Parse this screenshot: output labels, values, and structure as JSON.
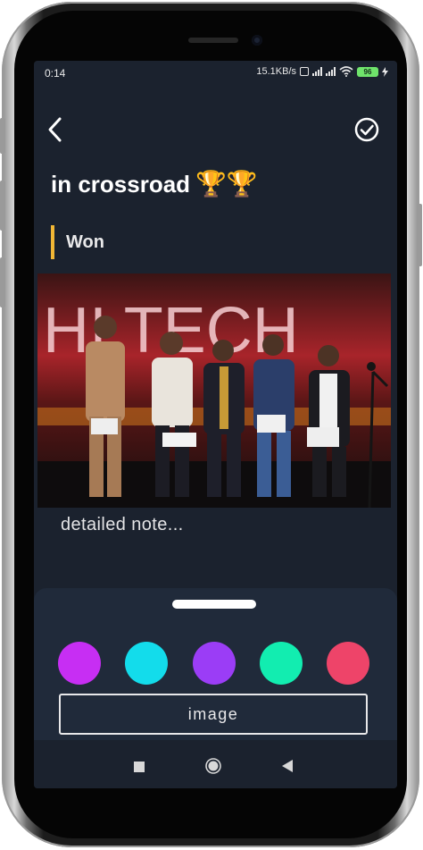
{
  "status_bar": {
    "time": "0:14",
    "network_speed": "15.1KB/s",
    "battery": "96"
  },
  "header": {
    "back_icon": "chevron-left-icon",
    "confirm_icon": "check-circle-icon"
  },
  "note": {
    "title": "in crossroad",
    "title_emoji": "🏆🏆",
    "status": "Won",
    "status_color": "#f2b735",
    "body_placeholder": "detailed note..."
  },
  "photo": {
    "banner_text": "HI TECH"
  },
  "sheet": {
    "colors": [
      "#c72ef3",
      "#13dceb",
      "#9b3df6",
      "#12edb0",
      "#ee4469"
    ],
    "image_button_label": "image"
  },
  "nav": {
    "recents_icon": "square-icon",
    "home_icon": "circle-icon",
    "back_icon": "triangle-back-icon"
  }
}
